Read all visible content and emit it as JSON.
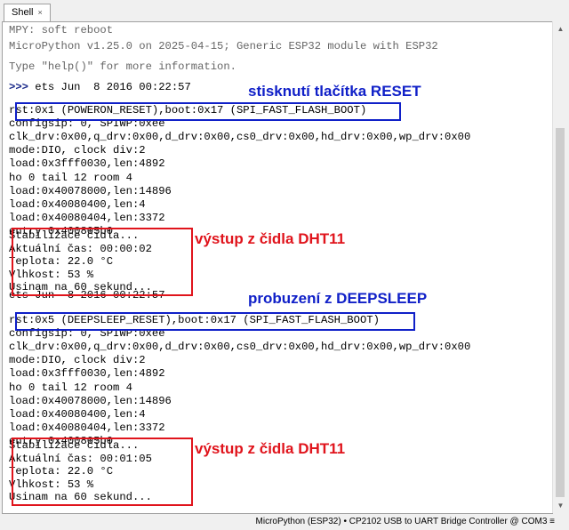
{
  "tab": {
    "label": "Shell",
    "close": "×"
  },
  "shell": {
    "header_lines": [
      "MPY: soft reboot",
      "MicroPython v1.25.0 on 2025-04-15; Generic ESP32 module with ESP32",
      "Type \"help()\" for more information."
    ],
    "prompt": ">>>",
    "first_line": " ets Jun  8 2016 00:22:57",
    "boot1": [
      "rst:0x1 (POWERON_RESET),boot:0x17 (SPI_FAST_FLASH_BOOT)",
      "configsip: 0, SPIWP:0xee",
      "clk_drv:0x00,q_drv:0x00,d_drv:0x00,cs0_drv:0x00,hd_drv:0x00,wp_drv:0x00",
      "mode:DIO, clock div:2",
      "load:0x3fff0030,len:4892",
      "ho 0 tail 12 room 4",
      "load:0x40078000,len:14896",
      "load:0x40080400,len:4",
      "load:0x40080404,len:3372",
      "entry 0x400805b0"
    ],
    "output1": [
      "Stabilizace čidla...",
      "Aktuální čas: 00:00:02",
      "Teplota: 22.0 °C",
      "Vlhkost: 53 %",
      "Usinam na 60 sekund..."
    ],
    "ets2": "ets Jun  8 2016 00:22:57",
    "boot2": [
      "rst:0x5 (DEEPSLEEP_RESET),boot:0x17 (SPI_FAST_FLASH_BOOT)",
      "configsip: 0, SPIWP:0xee",
      "clk_drv:0x00,q_drv:0x00,d_drv:0x00,cs0_drv:0x00,hd_drv:0x00,wp_drv:0x00",
      "mode:DIO, clock div:2",
      "load:0x3fff0030,len:4892",
      "ho 0 tail 12 room 4",
      "load:0x40078000,len:14896",
      "load:0x40080400,len:4",
      "load:0x40080404,len:3372",
      "entry 0x400805b0"
    ],
    "output2": [
      "Stabilizace čidla...",
      "Aktuální čas: 00:01:05",
      "Teplota: 22.0 °C",
      "Vlhkost: 53 %",
      "Usinam na 60 sekund..."
    ]
  },
  "annotations": {
    "reset": "stisknutí tlačítka RESET",
    "dht1": "výstup z čidla DHT11",
    "deepsleep": "probuzení z DEEPSLEEP",
    "dht2": "výstup z čidla DHT11"
  },
  "statusbar": {
    "text": "MicroPython (ESP32)  •  CP2102 USB to UART Bridge Controller @ COM3  ≡"
  },
  "colors": {
    "annotation_blue": "#1020c8",
    "annotation_red": "#e0141c",
    "prompt": "#1a2a8a"
  }
}
